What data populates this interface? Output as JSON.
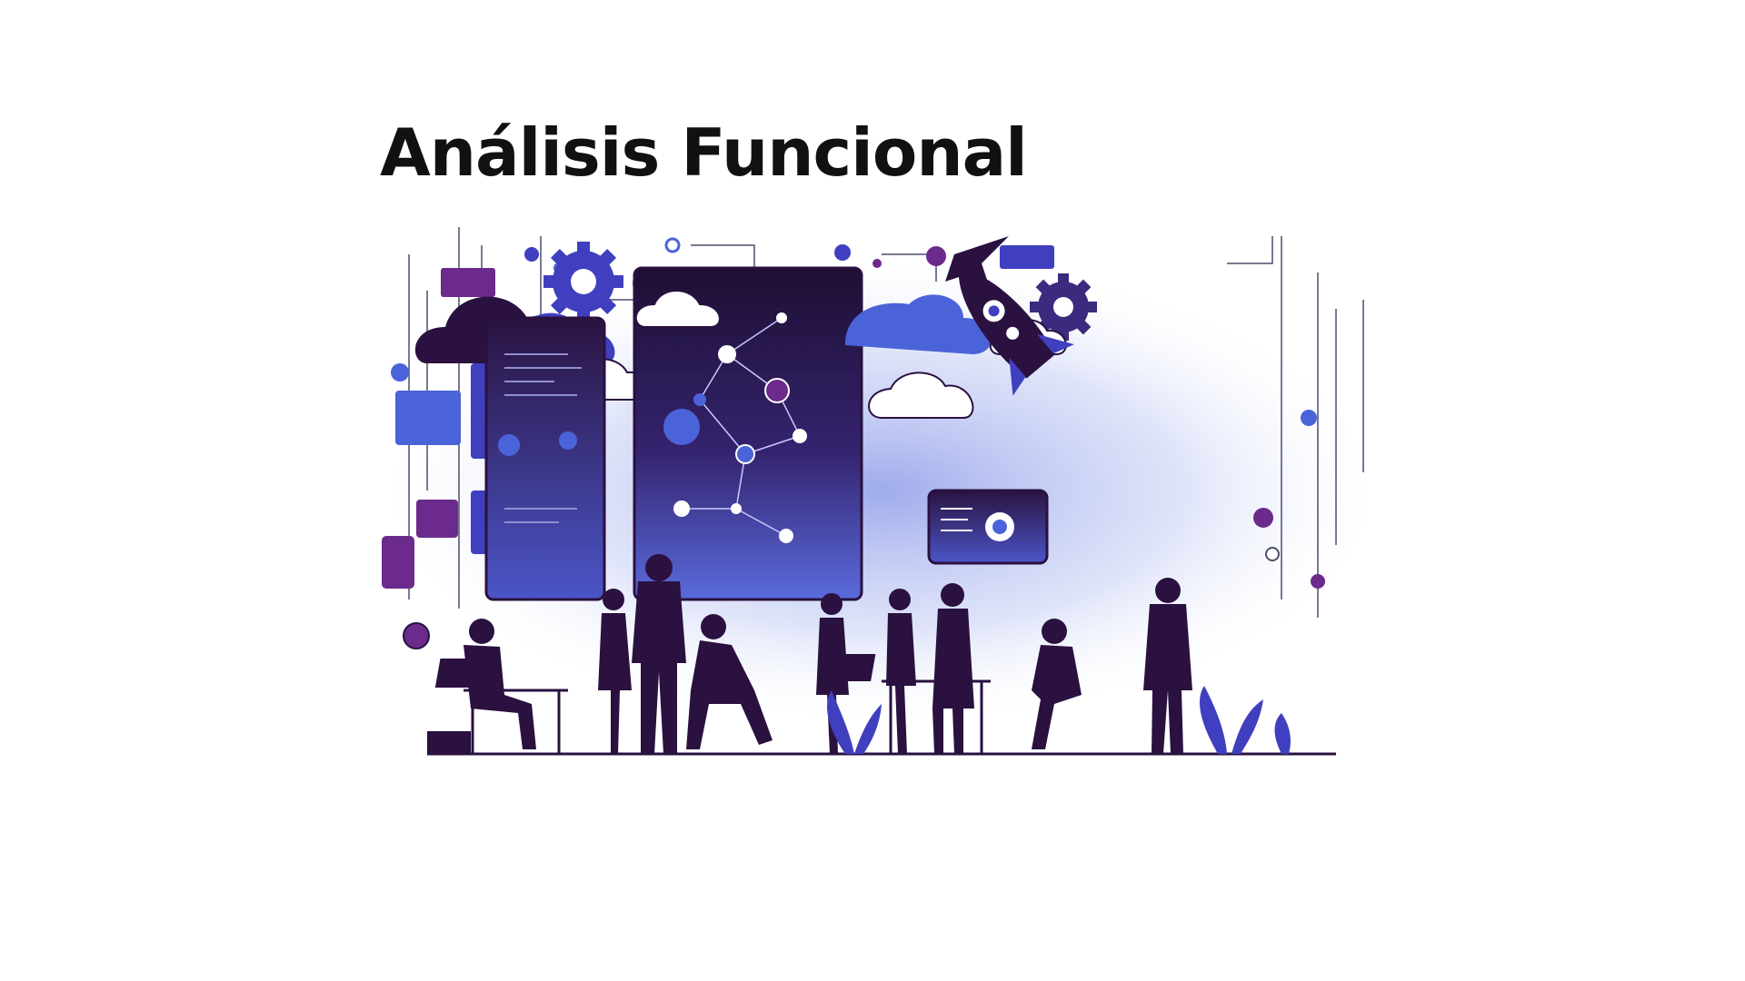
{
  "slide": {
    "title": "Análisis Funcional"
  },
  "illustration": {
    "description_icon": "tech-teamwork-illustration",
    "palette": {
      "primary": "#2a1140",
      "indigo": "#3f3fbf",
      "violet": "#6b2a8c",
      "accent_blue": "#4a63d8",
      "glow": "#b9c4f2",
      "cloud": "#ffffff",
      "line": "#4d4d6e"
    }
  }
}
